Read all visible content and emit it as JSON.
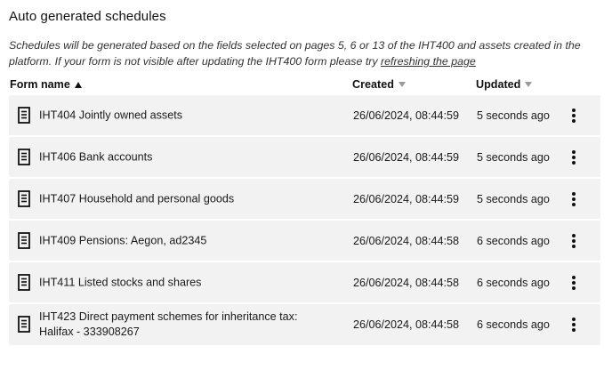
{
  "section": {
    "title": "Auto generated schedules",
    "description_pre": "Schedules will be generated based on the fields selected on pages 5, 6 or 13 of the IHT400 and assets created in the platform. If your form is not visible after updating the IHT400 form please try ",
    "description_link": "refreshing the page"
  },
  "table": {
    "columns": {
      "name": "Form name",
      "created": "Created",
      "updated": "Updated"
    },
    "sort": {
      "name": "ascending",
      "created": "none",
      "updated": "none"
    },
    "rows": [
      {
        "name": "IHT404 Jointly owned assets",
        "created": "26/06/2024, 08:44:59",
        "updated": "5 seconds ago",
        "icon": "document-icon",
        "actions_icon": "more-vertical-icon"
      },
      {
        "name": "IHT406 Bank accounts",
        "created": "26/06/2024, 08:44:59",
        "updated": "5 seconds ago",
        "icon": "document-icon",
        "actions_icon": "more-vertical-icon"
      },
      {
        "name": "IHT407 Household and personal goods",
        "created": "26/06/2024, 08:44:59",
        "updated": "5 seconds ago",
        "icon": "document-icon",
        "actions_icon": "more-vertical-icon"
      },
      {
        "name": "IHT409 Pensions: Aegon, ad2345",
        "created": "26/06/2024, 08:44:58",
        "updated": "6 seconds ago",
        "icon": "document-icon",
        "actions_icon": "more-vertical-icon"
      },
      {
        "name": "IHT411 Listed stocks and shares",
        "created": "26/06/2024, 08:44:58",
        "updated": "6 seconds ago",
        "icon": "document-icon",
        "actions_icon": "more-vertical-icon"
      },
      {
        "name": "IHT423 Direct payment schemes for inheritance tax: Halifax - 333908267",
        "created": "26/06/2024, 08:44:58",
        "updated": "6 seconds ago",
        "icon": "document-icon",
        "actions_icon": "more-vertical-icon"
      }
    ]
  },
  "colors": {
    "row_background": "#f2f2f2",
    "text": "#1a1a1a",
    "sort_inactive": "#9a9a9a"
  }
}
